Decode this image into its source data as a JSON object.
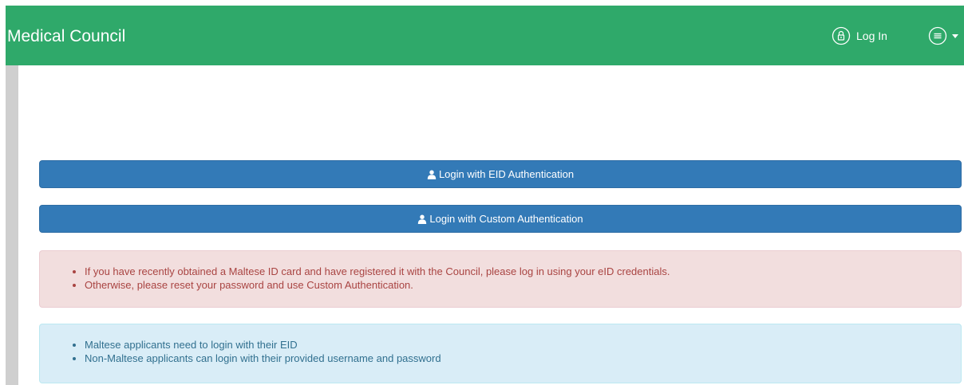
{
  "header": {
    "brand": "Medical Council",
    "login_label": "Log In",
    "login_icon": "lock-circle-icon",
    "menu_icon": "menu-circle-icon",
    "background_color": "#2fa96a"
  },
  "buttons": {
    "eid_label": "Login with EID Authentication",
    "custom_label": "Login with Custom Authentication",
    "icon": "user-icon",
    "color": "#337ab7"
  },
  "alert_danger": {
    "items": [
      "If you have recently obtained a Maltese ID card and have registered it with the Council, please log in using your eID credentials.",
      "Otherwise, please reset your password and use Custom Authentication."
    ]
  },
  "alert_info": {
    "items": [
      "Maltese applicants need to login with their EID",
      "Non-Maltese applicants can login with their provided username and password"
    ]
  }
}
